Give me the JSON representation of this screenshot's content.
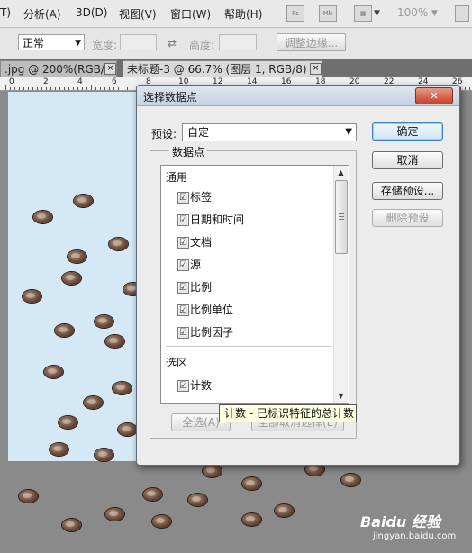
{
  "menubar": {
    "items": [
      "T)",
      "分析(A)",
      "3D(D)",
      "视图(V)",
      "窗口(W)",
      "帮助(H)"
    ],
    "toolbar_icons": [
      "ps-icon",
      "mb-icon",
      "screen-mode-icon"
    ],
    "zoom": "100%"
  },
  "options": {
    "style_value": "正常",
    "width_label": "宽度:",
    "height_label": "高度:",
    "refine_edge_label": "调整边缘..."
  },
  "tabs": [
    {
      "label": ".jpg @ 200%(RGB/8)",
      "close": "×"
    },
    {
      "label": "未标题-3 @ 66.7% (图层 1, RGB/8) *",
      "close": "×"
    }
  ],
  "ruler": {
    "labels": [
      "0",
      "2",
      "4",
      "6",
      "8",
      "10",
      "12",
      "14",
      "16",
      "18",
      "20",
      "22",
      "24",
      "26"
    ]
  },
  "dialog": {
    "title": "选择数据点",
    "close_label": "✕",
    "preset_label": "预设:",
    "preset_value": "自定",
    "group_label": "数据点",
    "sections": [
      {
        "title": "通用",
        "items": [
          {
            "label": "标签",
            "checked": true
          },
          {
            "label": "日期和时间",
            "checked": true
          },
          {
            "label": "文档",
            "checked": true
          },
          {
            "label": "源",
            "checked": true
          },
          {
            "label": "比例",
            "checked": true
          },
          {
            "label": "比例单位",
            "checked": true
          },
          {
            "label": "比例因子",
            "checked": true
          }
        ]
      },
      {
        "title": "选区",
        "items": [
          {
            "label": "计数",
            "checked": true
          }
        ]
      }
    ],
    "check_glyph": "☑",
    "select_all_label": "全选(A)",
    "deselect_all_label": "全部取消选择(E)",
    "ok_label": "确定",
    "cancel_label": "取消",
    "save_preset_label": "存储预设...",
    "delete_preset_label": "删除预设"
  },
  "tooltip": "计数 - 已标识特征的总计数",
  "watermark": {
    "top": "Baidu 经验",
    "bottom": "jingyan.baidu.com"
  },
  "colors": {
    "canvas_bg": "#d4e9f5",
    "dialog_accent": "#3b7fc4",
    "tooltip_bg": "#ffffe1"
  }
}
